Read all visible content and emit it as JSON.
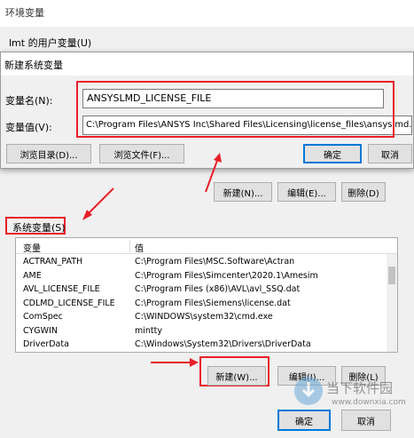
{
  "env_window": {
    "title": "环境变量",
    "user_vars_label": "lmt 的用户变量(U)"
  },
  "dialog": {
    "title": "新建系统变量",
    "name_label": "变量名(N):",
    "name_value": "ANSYSLMD_LICENSE_FILE",
    "value_label": "变量值(V):",
    "value_value": "C:\\Program Files\\ANSYS Inc\\Shared Files\\Licensing\\license_files\\ansyslmd.lic",
    "browse_dir": "浏览目录(D)...",
    "browse_file": "浏览文件(F)...",
    "ok": "确定",
    "cancel": "取消"
  },
  "user_buttons": {
    "new": "新建(N)...",
    "edit": "编辑(E)...",
    "delete": "删除(D)"
  },
  "system_vars": {
    "label": "系统变量(S)",
    "col_var": "变量",
    "col_val": "值",
    "rows": [
      {
        "name": "ACTRAN_PATH",
        "value": "C:\\Program Files\\MSC.Software\\Actran"
      },
      {
        "name": "AME",
        "value": "C:\\Program Files\\Simcenter\\2020.1\\Amesim"
      },
      {
        "name": "AVL_LICENSE_FILE",
        "value": "C:\\Program Files (x86)\\AVL\\avl_SSQ.dat"
      },
      {
        "name": "CDLMD_LICENSE_FILE",
        "value": "C:\\Program Files\\Siemens\\license.dat"
      },
      {
        "name": "ComSpec",
        "value": "C:\\WINDOWS\\system32\\cmd.exe"
      },
      {
        "name": "CYGWIN",
        "value": "mintty"
      },
      {
        "name": "DriverData",
        "value": "C:\\Windows\\System32\\Drivers\\DriverData"
      }
    ],
    "new": "新建(W)...",
    "edit": "编辑(I)...",
    "delete": "删除(L)"
  },
  "footer": {
    "ok": "确定",
    "cancel": "取消"
  },
  "watermark": {
    "line1": "当下软件园",
    "line2": "www.downxia.com"
  },
  "colors": {
    "highlight": "#e8202a",
    "accent": "#0078d7"
  }
}
